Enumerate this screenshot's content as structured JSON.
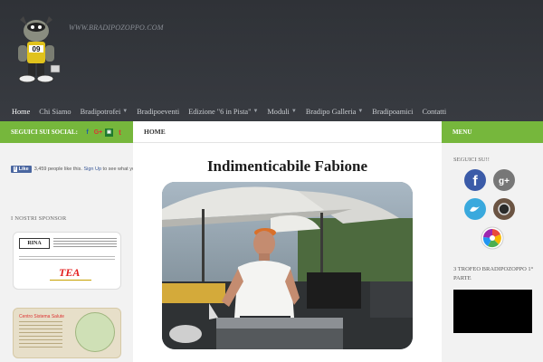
{
  "site": {
    "url": "WWW.BRADIPOZOPPO.COM",
    "logo_number": "09"
  },
  "nav": {
    "items": [
      {
        "label": "Home",
        "active": true,
        "dropdown": false
      },
      {
        "label": "Chi Siamo",
        "active": false,
        "dropdown": false
      },
      {
        "label": "Bradipotrofei",
        "active": false,
        "dropdown": true
      },
      {
        "label": "Bradipoeventi",
        "active": false,
        "dropdown": false
      },
      {
        "label": "Edizione \"6 in Pista\"",
        "active": false,
        "dropdown": true
      },
      {
        "label": "Moduli",
        "active": false,
        "dropdown": true
      },
      {
        "label": "Bradipo Galleria",
        "active": false,
        "dropdown": true
      },
      {
        "label": "Bradipoamici",
        "active": false,
        "dropdown": false
      },
      {
        "label": "Contatti",
        "active": false,
        "dropdown": false
      }
    ]
  },
  "left_sidebar": {
    "social_title": "SEGUICI SUI SOCIAL:",
    "social_icons": [
      "facebook-icon",
      "google-plus-icon",
      "square-icon",
      "twitter-icon"
    ],
    "social_glyphs": [
      "f",
      "G+",
      "▣",
      "t"
    ],
    "fb_like": {
      "button": "Like",
      "count_text": "3,459 people like this.",
      "signup": "Sign Up",
      "rest": "to see what you"
    },
    "sponsor_title": "I NOSTRI SPONSOR",
    "sponsor1": {
      "cert": "RINA",
      "brand": "TEA"
    },
    "sponsor2": {
      "brand": "Centro Sistema Salute"
    }
  },
  "main": {
    "breadcrumb": "HOME",
    "title": "Indimenticabile Fabione"
  },
  "right_sidebar": {
    "menu_title": "MENU",
    "follow_title": "SEGUICI SU!!",
    "icons": [
      "facebook-icon",
      "google-plus-icon",
      "twitter-icon",
      "instagram-icon",
      "picasa-icon"
    ],
    "trofeo_title": "3 TROFEO BRADIPOZOPPO 1° PARTE"
  },
  "colors": {
    "accent_green": "#76b73c",
    "header_bg": "#34373c"
  }
}
